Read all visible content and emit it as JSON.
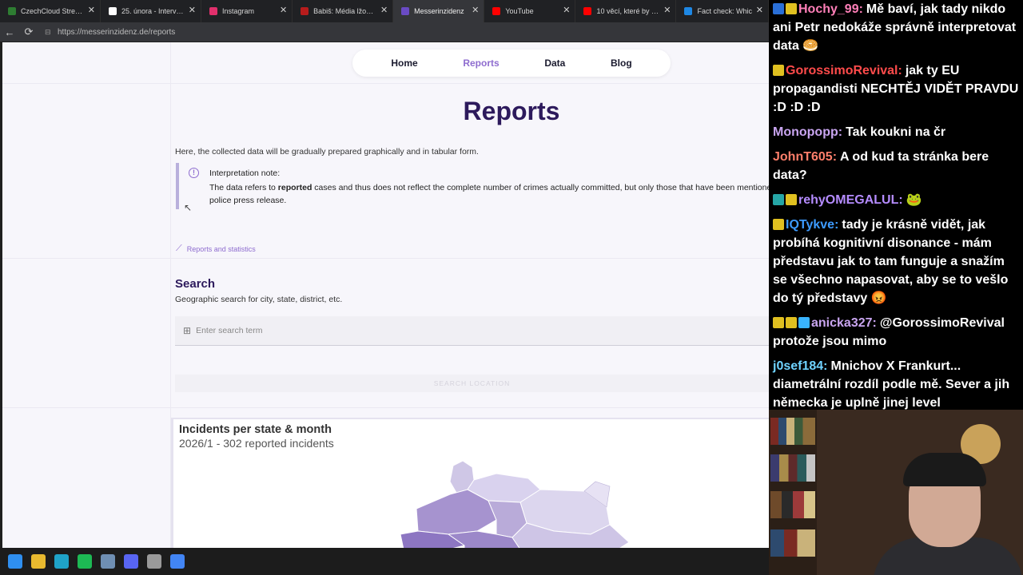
{
  "browser": {
    "tabs": [
      {
        "title": "CzechCloud Stream - Wi",
        "favicon_color": "#2e7d32",
        "active": false
      },
      {
        "title": "25. února - Interview ČT",
        "favicon_color": "#ffffff",
        "active": false
      },
      {
        "title": "Instagram",
        "favicon_color": "#e1306c",
        "active": false
      },
      {
        "title": "Babiš: Média lžou, opoz",
        "favicon_color": "#b71c1c",
        "active": false
      },
      {
        "title": "Messerinzidenz",
        "favicon_color": "#6a4bc4",
        "active": true
      },
      {
        "title": "YouTube",
        "favicon_color": "#ff0000",
        "active": false
      },
      {
        "title": "10 věcí, které by Hitlera",
        "favicon_color": "#ff0000",
        "active": false
      },
      {
        "title": "Fact check: Whic",
        "favicon_color": "#1e88e5",
        "active": false
      }
    ],
    "close_glyph": "✕",
    "url": "https://messerinzidenz.de/reports"
  },
  "nav": {
    "home": "Home",
    "reports": "Reports",
    "data": "Data",
    "blog": "Blog"
  },
  "page": {
    "title": "Reports",
    "intro": "Here, the collected data will be gradually prepared graphically and in tabular form.",
    "note_icon": "!",
    "note_title": "Interpretation note:",
    "note_body_pre": "The data refers to ",
    "note_body_bold": "reported",
    "note_body_post": " cases and thus does not reflect the complete number of crimes actually committed, but only those that have been mentioned in a police press release.",
    "crumb": "Reports and statistics"
  },
  "search": {
    "heading": "Search",
    "subtitle": "Geographic search for city, state, district, etc.",
    "placeholder": "Enter search term",
    "button": "SEARCH LOCATION"
  },
  "card": {
    "title": "Incidents per state & month",
    "subtitle": "2026/1 - 302 reported incidents"
  },
  "chat": [
    {
      "user": "Hochy_99:",
      "color": "#ff7fb8",
      "badges": [
        "#2a6fd6",
        "#e0c020"
      ],
      "text": "Mě baví, jak tady nikdo ani Petr nedokáže správně interpretovat data 🥯"
    },
    {
      "user": "GorossimoRevival:",
      "color": "#ff4b4b",
      "badges": [
        "#e0c020"
      ],
      "text": "jak ty EU propagandisti NECHTĚJ VIDĚT PRAVDU :D :D :D"
    },
    {
      "user": "Monopopp:",
      "color": "#c9a5f0",
      "badges": [],
      "text": "Tak koukni na čr"
    },
    {
      "user": "JohnT605:",
      "color": "#ff7f6b",
      "badges": [],
      "text": "A od kud ta stránka bere data?"
    },
    {
      "user": "rehyOMEGALUL:",
      "color": "#b58cff",
      "badges": [
        "#26a6a6",
        "#e0c020"
      ],
      "text": "🐸"
    },
    {
      "user": "IQTykve:",
      "color": "#3d9bff",
      "badges": [
        "#e0c020"
      ],
      "text": "tady je krásně vidět, jak probíhá kognitivní disonance - mám představu jak to tam funguje a snažím se všechno napasovat, aby se to vešlo do tý představy 😡"
    },
    {
      "user": "anicka327:",
      "color": "#c9a5f0",
      "badges": [
        "#e0c020",
        "#e0c020",
        "#39b4ff"
      ],
      "text": "@GorossimoRevival protože jsou mimo"
    },
    {
      "user": "j0sef184:",
      "color": "#6fd3ff",
      "badges": [],
      "text": "Mnichov X Frankurt... diametrální rozdíl podle mě. Sever a jih německa je uplně jinej level"
    }
  ],
  "taskbar": {
    "icons": [
      {
        "name": "windows-start-icon",
        "color": "#2f8ff0"
      },
      {
        "name": "file-explorer-icon",
        "color": "#e8b92f"
      },
      {
        "name": "edge-icon",
        "color": "#1fa3c8"
      },
      {
        "name": "spotify-icon",
        "color": "#1db954"
      },
      {
        "name": "steam-icon",
        "color": "#6f8fb3"
      },
      {
        "name": "discord-icon",
        "color": "#5865f2"
      },
      {
        "name": "app-icon",
        "color": "#9a9a9a"
      },
      {
        "name": "chrome-icon",
        "color": "#4285f4"
      }
    ]
  }
}
